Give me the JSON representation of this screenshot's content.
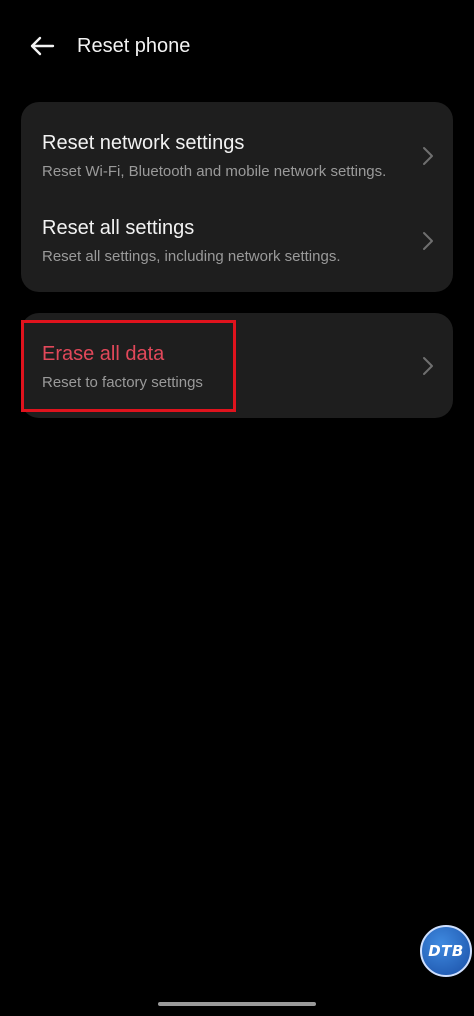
{
  "header": {
    "title": "Reset phone",
    "back_icon": "arrow-left-icon"
  },
  "reset_options": [
    {
      "title": "Reset network settings",
      "subtitle": "Reset Wi-Fi, Bluetooth and mobile network settings."
    },
    {
      "title": "Reset all settings",
      "subtitle": "Reset all settings, including network settings."
    }
  ],
  "erase": {
    "title": "Erase all data",
    "subtitle": "Reset to factory settings"
  },
  "watermark": {
    "text": "DTB"
  },
  "colors": {
    "background": "#000000",
    "card": "#1e1e1e",
    "title_text": "#f2f2f2",
    "subtitle_text": "#9a9a9a",
    "danger": "#e2485a",
    "highlight": "#e0131d"
  }
}
